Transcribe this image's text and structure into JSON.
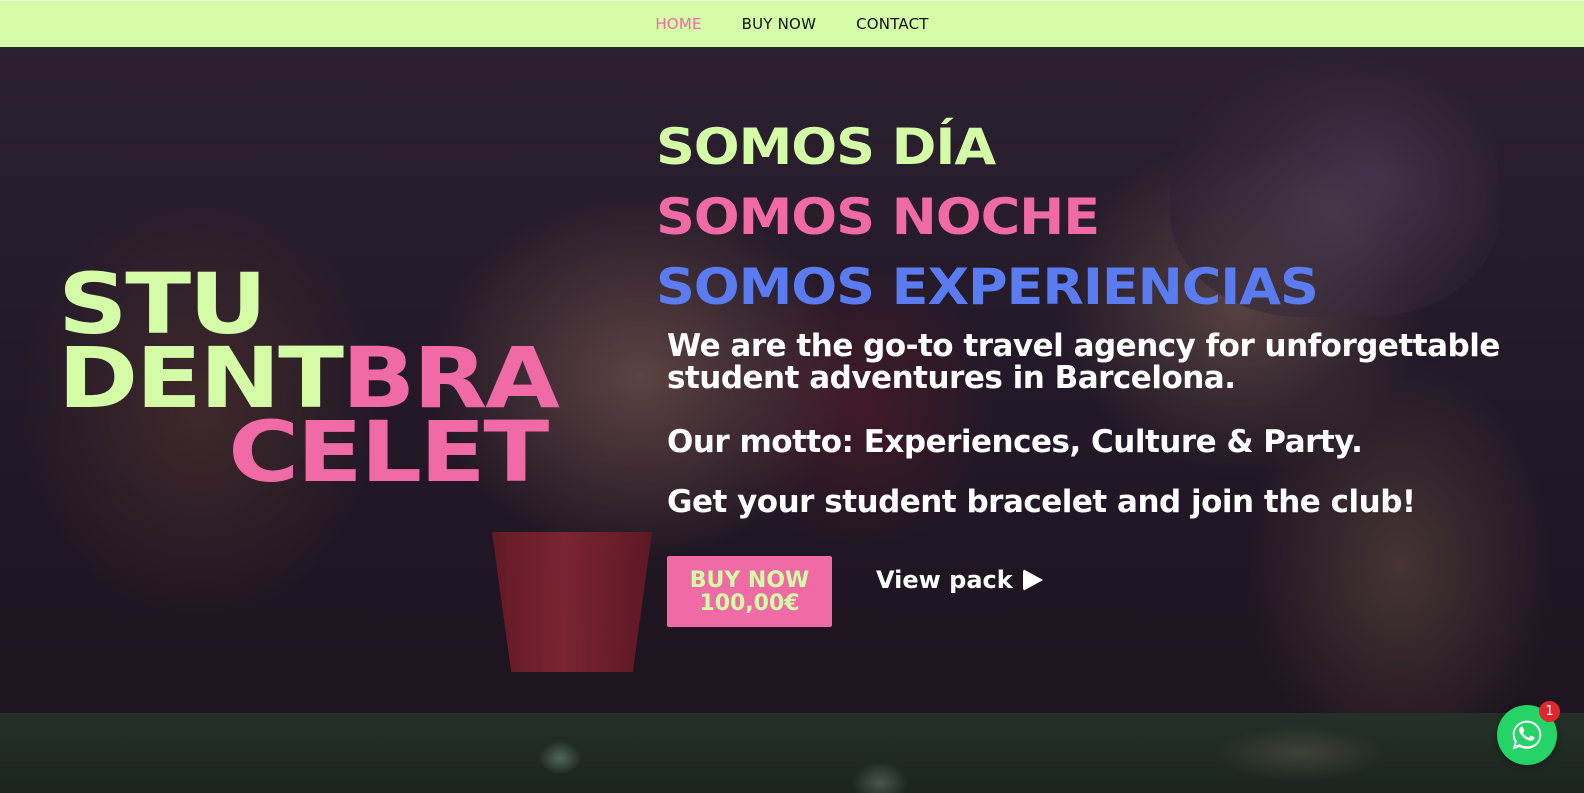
{
  "nav": {
    "items": [
      {
        "label": "HOME",
        "active": true
      },
      {
        "label": "BUY NOW",
        "active": false
      },
      {
        "label": "CONTACT",
        "active": false
      }
    ]
  },
  "logo": {
    "line1": "STU",
    "line2_green": "DENT",
    "line2_pink": "BRA",
    "line3": "CELET"
  },
  "slogans": {
    "day": "SOMOS DÍA",
    "night": "SOMOS NOCHE",
    "experiences": "SOMOS EXPERIENCIAS"
  },
  "copy": {
    "intro": "We are the go-to travel agency for unforgettable student adventures in Barcelona.",
    "motto": "Our motto: Experiences, Culture & Party.",
    "cta": "Get your student bracelet and join the club!"
  },
  "buttons": {
    "buy_line1": "BUY NOW",
    "buy_line2": "100,00€",
    "view_pack": "View pack"
  },
  "whatsapp": {
    "badge_count": "1"
  },
  "colors": {
    "lime": "#d4fca6",
    "pink": "#f06aa6",
    "blue": "#5b7cf0",
    "whatsapp": "#25d366"
  }
}
